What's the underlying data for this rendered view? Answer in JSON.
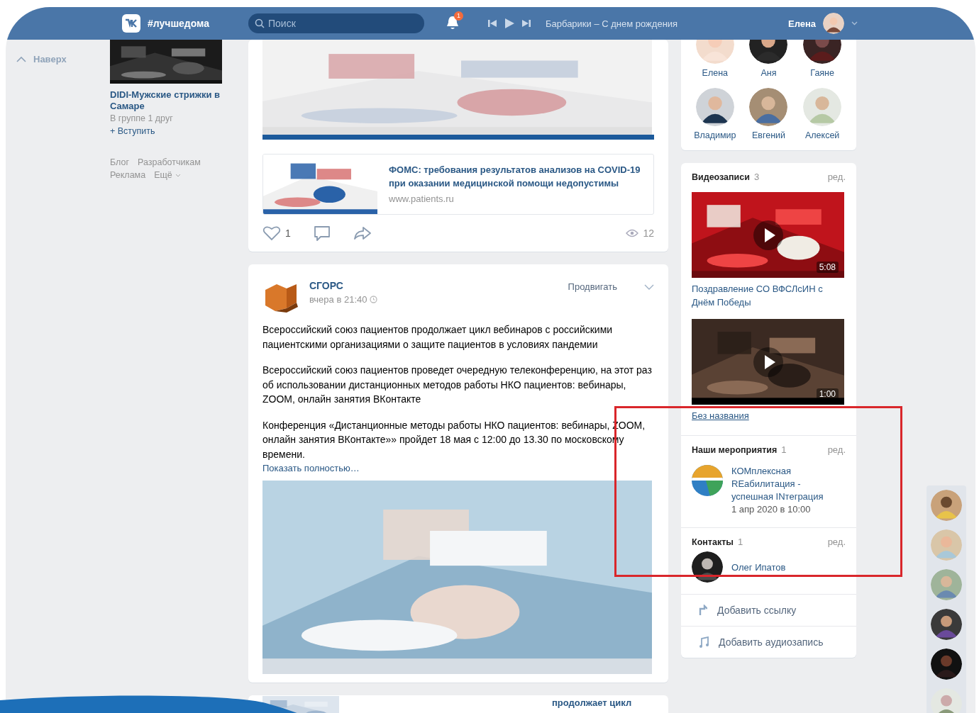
{
  "header": {
    "logo_text": "#лучшедома",
    "search": {
      "placeholder": "Поиск"
    },
    "notifications_badge": "1",
    "player": {
      "track": "Барбарики – С днем рождения"
    },
    "user": {
      "name": "Елена"
    }
  },
  "left_nav": {
    "back_to_top": "Наверх",
    "ad": {
      "kind": "picture",
      "title": "DIDI-Мужские стрижки в Самаре",
      "meta": "В группе 1 друг",
      "join": "+ Вступить"
    },
    "footer_links": [
      {
        "label": "Блог",
        "dropdown": false
      },
      {
        "label": "Разработчикам",
        "dropdown": false
      },
      {
        "label": "Реклама",
        "dropdown": false
      },
      {
        "label": "Ещё",
        "dropdown": true
      }
    ]
  },
  "feed": {
    "posts": [
      {
        "kind": "repost",
        "link": {
          "title": "ФОМС: требования результатов анализов на COVID-19 при оказании медицинской помощи недопустимы",
          "url": "www.patients.ru"
        },
        "likes": "1",
        "views": "12"
      },
      {
        "kind": "post",
        "author": "СГОРС",
        "time": "вчера в 21:40",
        "promote": "Продвигать",
        "paragraphs": [
          "Всероссийский союз пациентов продолжает цикл вебинаров с российскими пациентскими организациями о защите пациентов в условиях пандемии",
          "Всероссийский союз пациентов проведет очередную телеконференцию, на этот раз об использовании дистанционных методов работы НКО пациентов: вебинары, ZOOM, онлайн занятия ВКонтакте",
          "Конференция «Дистанционные методы работы НКО пациентов: вебинары, ZOOM, онлайн занятия ВКонтакте»» пройдет 18 мая с 12:00 до 13.30 по московскому времени."
        ],
        "more": "Показать полностью…"
      },
      {
        "kind": "partial",
        "link": {
          "title": "продолжает цикл"
        }
      }
    ]
  },
  "right": {
    "friends": [
      "Елена",
      "Аня",
      "Гаяне",
      "Владимир",
      "Евгений",
      "Алексей"
    ],
    "videos": {
      "title": "Видеозаписи",
      "count": "3",
      "edit": "ред.",
      "items": [
        {
          "duration": "5:08",
          "title": "Поздравление СО ВФСЛсИН с Днём Победы"
        },
        {
          "duration": "1:00",
          "title": "Без названия"
        }
      ]
    },
    "events": {
      "title": "Наши мероприятия",
      "count": "1",
      "edit": "ред.",
      "items": [
        {
          "name": "КОМплексная REабилитация - успешная INтеграция",
          "date": "1 апр 2020 в 10:00"
        }
      ]
    },
    "contacts": {
      "title": "Контакты",
      "count": "1",
      "edit": "ред.",
      "items": [
        {
          "name": "Олег Ипатов"
        }
      ]
    },
    "actions": [
      {
        "kind": "link",
        "label": "Добавить ссылку"
      },
      {
        "kind": "audio",
        "label": "Добавить аудиозапись"
      }
    ]
  }
}
